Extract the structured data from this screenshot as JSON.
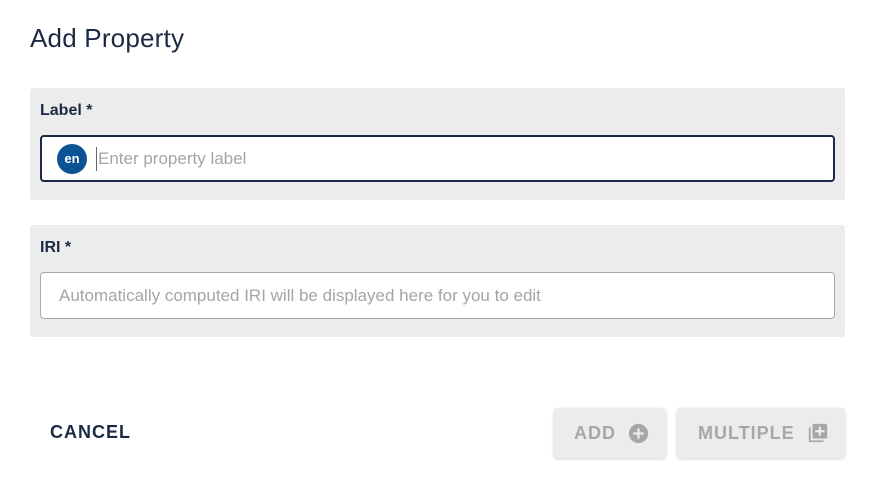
{
  "dialog": {
    "title": "Add Property"
  },
  "label_field": {
    "title": "Label *",
    "language": "en",
    "placeholder": "Enter property label",
    "value": ""
  },
  "iri_field": {
    "title": "IRI *",
    "placeholder": "Automatically computed IRI will be displayed here for you to edit",
    "value": ""
  },
  "actions": {
    "cancel_label": "CANCEL",
    "add_label": "ADD",
    "multiple_label": "MULTIPLE"
  },
  "icons": {
    "add": "plus-circle-icon",
    "multiple": "library-add-icon"
  },
  "colors": {
    "primary": "#1b2a44",
    "badge": "#0b5394",
    "panel": "#ececec",
    "disabled_text": "#a7a7a7"
  }
}
